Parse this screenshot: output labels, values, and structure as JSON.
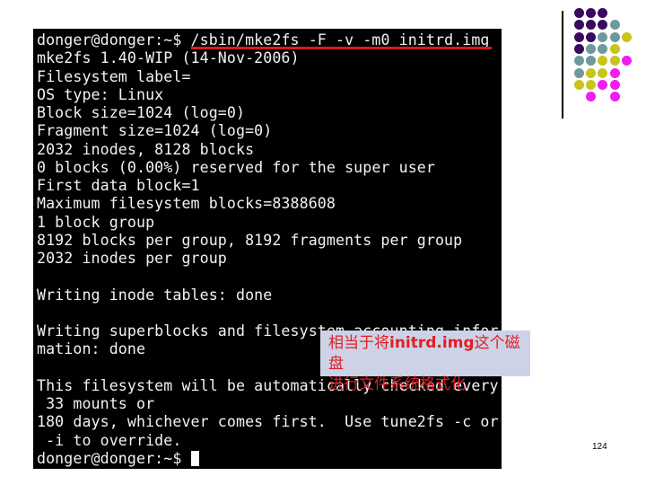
{
  "terminal": {
    "command_line": {
      "prompt": "donger@donger:~$ ",
      "command": "/sbin/mke2fs -F -v -m0 initrd.img"
    },
    "output_lines": [
      "mke2fs 1.40-WIP (14-Nov-2006)",
      "Filesystem label=",
      "OS type: Linux",
      "Block size=1024 (log=0)",
      "Fragment size=1024 (log=0)",
      "2032 inodes, 8128 blocks",
      "0 blocks (0.00%) reserved for the super user",
      "First data block=1",
      "Maximum filesystem blocks=8388608",
      "1 block group",
      "8192 blocks per group, 8192 fragments per group",
      "2032 inodes per group",
      "",
      "Writing inode tables: done",
      "",
      "Writing superblocks and filesystem accounting infor",
      "mation: done",
      "",
      "This filesystem will be automatically checked every",
      " 33 mounts or",
      "180 days, whichever comes first.  Use tune2fs -c or",
      " -i to override."
    ],
    "final_prompt": "donger@donger:~$ "
  },
  "annotation": {
    "line1_prefix": "相当于将",
    "line1_bold": "initrd.img",
    "line1_suffix": "这个磁盘",
    "line2": "进行文件系统格式化",
    "text_color": "#e01e26",
    "background_color": "#ced2e6"
  },
  "decoration": {
    "colors": {
      "purple": "#3a0a5e",
      "teal": "#6e9a9e",
      "yellow": "#c9c41a",
      "magenta": "#f01ef0"
    },
    "dot_rows": [
      [
        "purple",
        "purple",
        "purple",
        null,
        null
      ],
      [
        "purple",
        "purple",
        "purple",
        "teal",
        null
      ],
      [
        "purple",
        "purple",
        "teal",
        "teal",
        "yellow"
      ],
      [
        "purple",
        "teal",
        "teal",
        "yellow",
        null
      ],
      [
        "teal",
        "teal",
        "yellow",
        "yellow",
        "magenta"
      ],
      [
        "teal",
        "yellow",
        "yellow",
        "magenta",
        null
      ],
      [
        "yellow",
        "yellow",
        "magenta",
        "magenta",
        null
      ],
      [
        null,
        "magenta",
        null,
        "magenta",
        null
      ]
    ]
  },
  "slide": {
    "page_number": "124"
  }
}
